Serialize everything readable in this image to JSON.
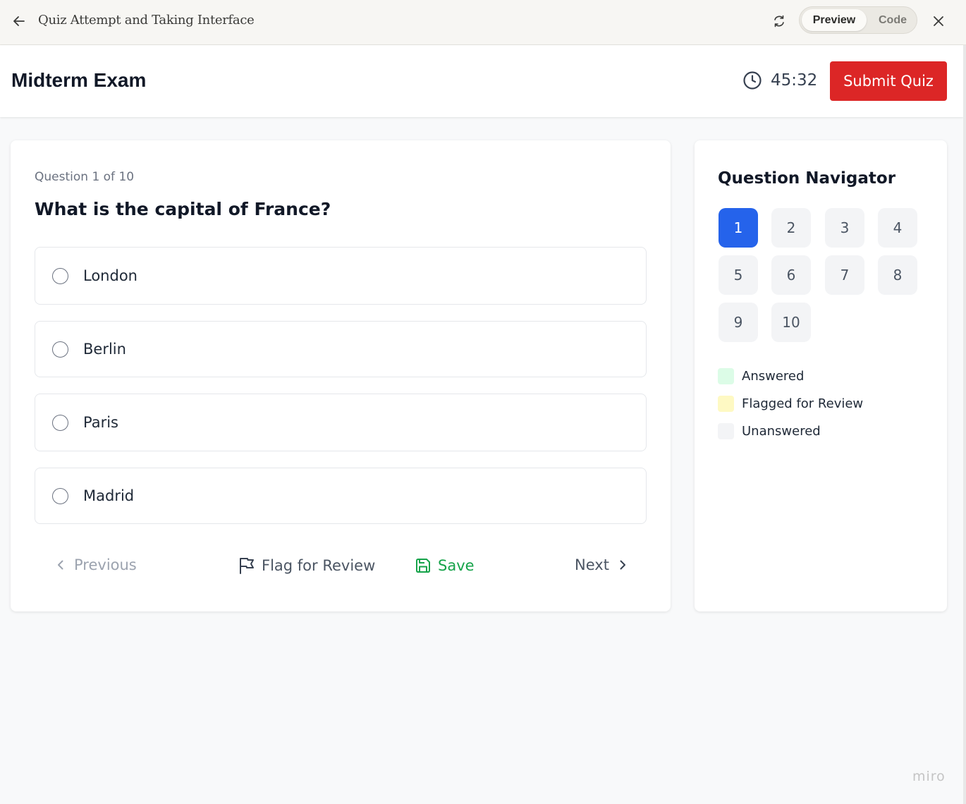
{
  "window": {
    "title": "Quiz Attempt and Taking Interface",
    "preview_label": "Preview",
    "code_label": "Code"
  },
  "header": {
    "exam_title": "Midterm Exam",
    "timer": "45:32",
    "submit_label": "Submit Quiz"
  },
  "question": {
    "counter": "Question 1 of 10",
    "text": "What is the capital of France?",
    "options": [
      "London",
      "Berlin",
      "Paris",
      "Madrid"
    ]
  },
  "actions": {
    "previous": "Previous",
    "flag": "Flag for Review",
    "save": "Save",
    "next": "Next"
  },
  "navigator": {
    "title": "Question Navigator",
    "questions": [
      "1",
      "2",
      "3",
      "4",
      "5",
      "6",
      "7",
      "8",
      "9",
      "10"
    ],
    "current": "1",
    "legend": [
      {
        "label": "Answered",
        "color": "#dcfce7"
      },
      {
        "label": "Flagged for Review",
        "color": "#fef9c3"
      },
      {
        "label": "Unanswered",
        "color": "#f3f4f6"
      }
    ]
  },
  "brand": "miro",
  "colors": {
    "submit": "#dc2626",
    "active_question": "#2563eb",
    "save": "#16a34a"
  }
}
